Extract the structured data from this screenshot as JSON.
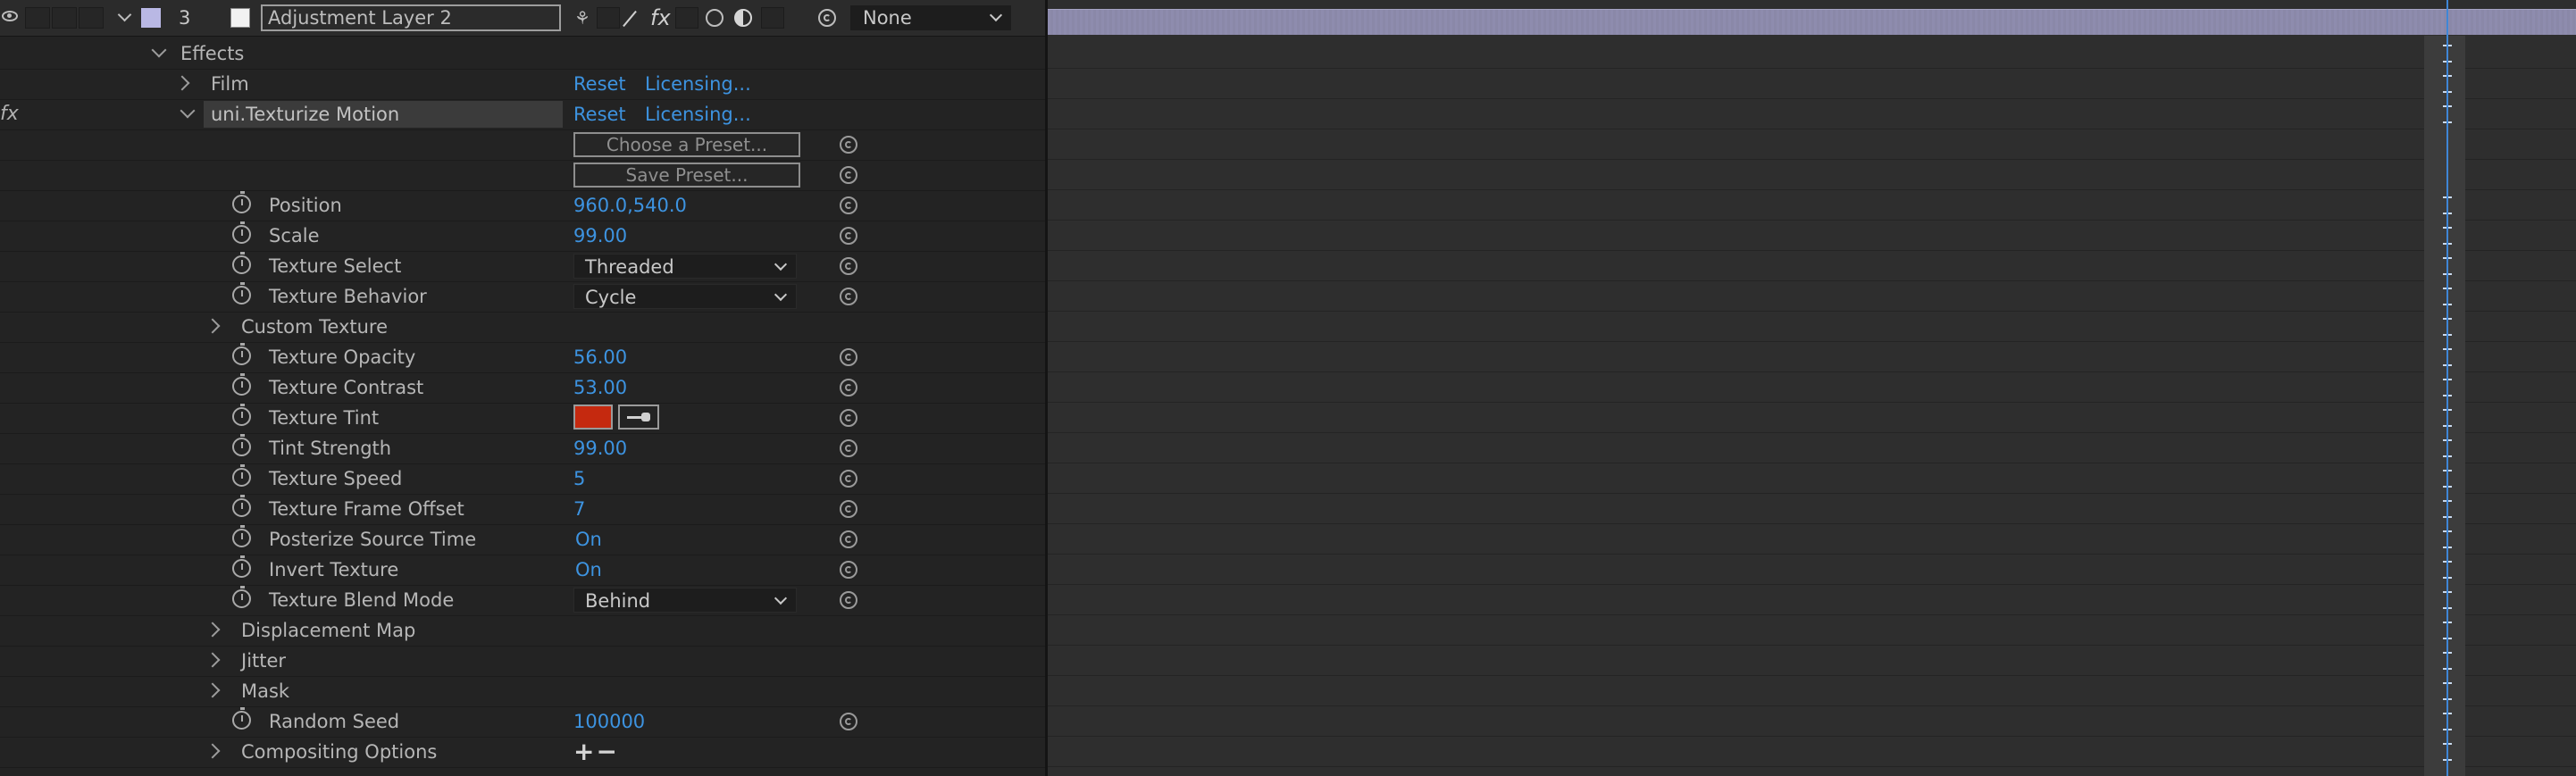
{
  "layer": {
    "number": "3",
    "name": "Adjustment Layer 2",
    "parent": "None",
    "label_color": "#b9b8e4"
  },
  "effects_header": "Effects",
  "fx_label": "fx",
  "film": {
    "label": "Film",
    "reset": "Reset",
    "licensing": "Licensing..."
  },
  "texturize": {
    "label": "uni.Texturize Motion",
    "reset": "Reset",
    "licensing": "Licensing..."
  },
  "presets": {
    "choose": "Choose a Preset...",
    "save": "Save Preset..."
  },
  "props": {
    "position": {
      "label": "Position",
      "value": "960.0,540.0"
    },
    "scale": {
      "label": "Scale",
      "value": "99.00"
    },
    "texture_select": {
      "label": "Texture Select",
      "value": "Threaded"
    },
    "texture_behavior": {
      "label": "Texture Behavior",
      "value": "Cycle"
    },
    "custom_texture": {
      "label": "Custom Texture"
    },
    "texture_opacity": {
      "label": "Texture Opacity",
      "value": "56.00"
    },
    "texture_contrast": {
      "label": "Texture Contrast",
      "value": "53.00"
    },
    "texture_tint": {
      "label": "Texture Tint",
      "color": "#c5290f"
    },
    "tint_strength": {
      "label": "Tint Strength",
      "value": "99.00"
    },
    "texture_speed": {
      "label": "Texture Speed",
      "value": "5"
    },
    "texture_frame_offset": {
      "label": "Texture Frame Offset",
      "value": "7"
    },
    "posterize_source_time": {
      "label": "Posterize Source Time",
      "value": "On"
    },
    "invert_texture": {
      "label": "Invert Texture",
      "value": "On"
    },
    "texture_blend_mode": {
      "label": "Texture Blend Mode",
      "value": "Behind"
    },
    "displacement_map": {
      "label": "Displacement Map"
    },
    "jitter": {
      "label": "Jitter"
    },
    "mask": {
      "label": "Mask"
    },
    "random_seed": {
      "label": "Random Seed",
      "value": "100000"
    },
    "compositing_options": {
      "label": "Compositing Options",
      "controls": "+−"
    }
  },
  "colors": {
    "link": "#3d93e0",
    "cti": "#3f86d6",
    "layer_bar": "#8c8aab"
  }
}
